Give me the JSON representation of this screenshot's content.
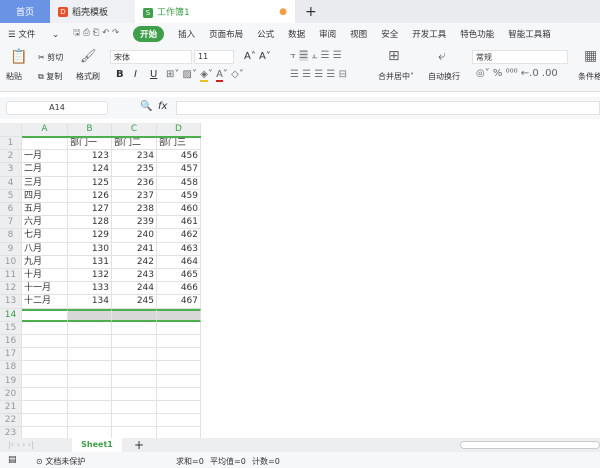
{
  "tabs": {
    "home": "首页",
    "template": "稻壳模板",
    "workbook": "工作簿1"
  },
  "menu": {
    "file": "文件",
    "items": [
      "开始",
      "插入",
      "页面布局",
      "公式",
      "数据",
      "审阅",
      "视图",
      "安全",
      "开发工具",
      "特色功能",
      "智能工具箱"
    ]
  },
  "ribbon": {
    "paste": "粘贴",
    "cut": "剪切",
    "copy": "复制",
    "format_painter": "格式刷",
    "font": "宋体",
    "font_size": "11",
    "merge": "合并居中",
    "wrap": "自动换行",
    "number_format": "常规",
    "cond_format": "条件格式",
    "bold": "B",
    "italic": "I",
    "underline": "U"
  },
  "formula_bar": {
    "name_box": "A14",
    "fx": "fx",
    "value": ""
  },
  "columns": [
    "A",
    "B",
    "C",
    "D"
  ],
  "rows": [
    [
      "",
      "部门一",
      "部门二",
      "部门三"
    ],
    [
      "一月",
      "123",
      "234",
      "456"
    ],
    [
      "二月",
      "124",
      "235",
      "457"
    ],
    [
      "三月",
      "125",
      "236",
      "458"
    ],
    [
      "四月",
      "126",
      "237",
      "459"
    ],
    [
      "五月",
      "127",
      "238",
      "460"
    ],
    [
      "六月",
      "128",
      "239",
      "461"
    ],
    [
      "七月",
      "129",
      "240",
      "462"
    ],
    [
      "八月",
      "130",
      "241",
      "463"
    ],
    [
      "九月",
      "131",
      "242",
      "464"
    ],
    [
      "十月",
      "132",
      "243",
      "465"
    ],
    [
      "十一月",
      "133",
      "244",
      "466"
    ],
    [
      "十二月",
      "134",
      "245",
      "467"
    ]
  ],
  "row_count": 23,
  "selected_row": 14,
  "sheet": {
    "name": "Sheet1"
  },
  "status": {
    "protect": "文档未保护",
    "sum": "求和=0",
    "avg": "平均值=0",
    "count": "计数=0"
  }
}
